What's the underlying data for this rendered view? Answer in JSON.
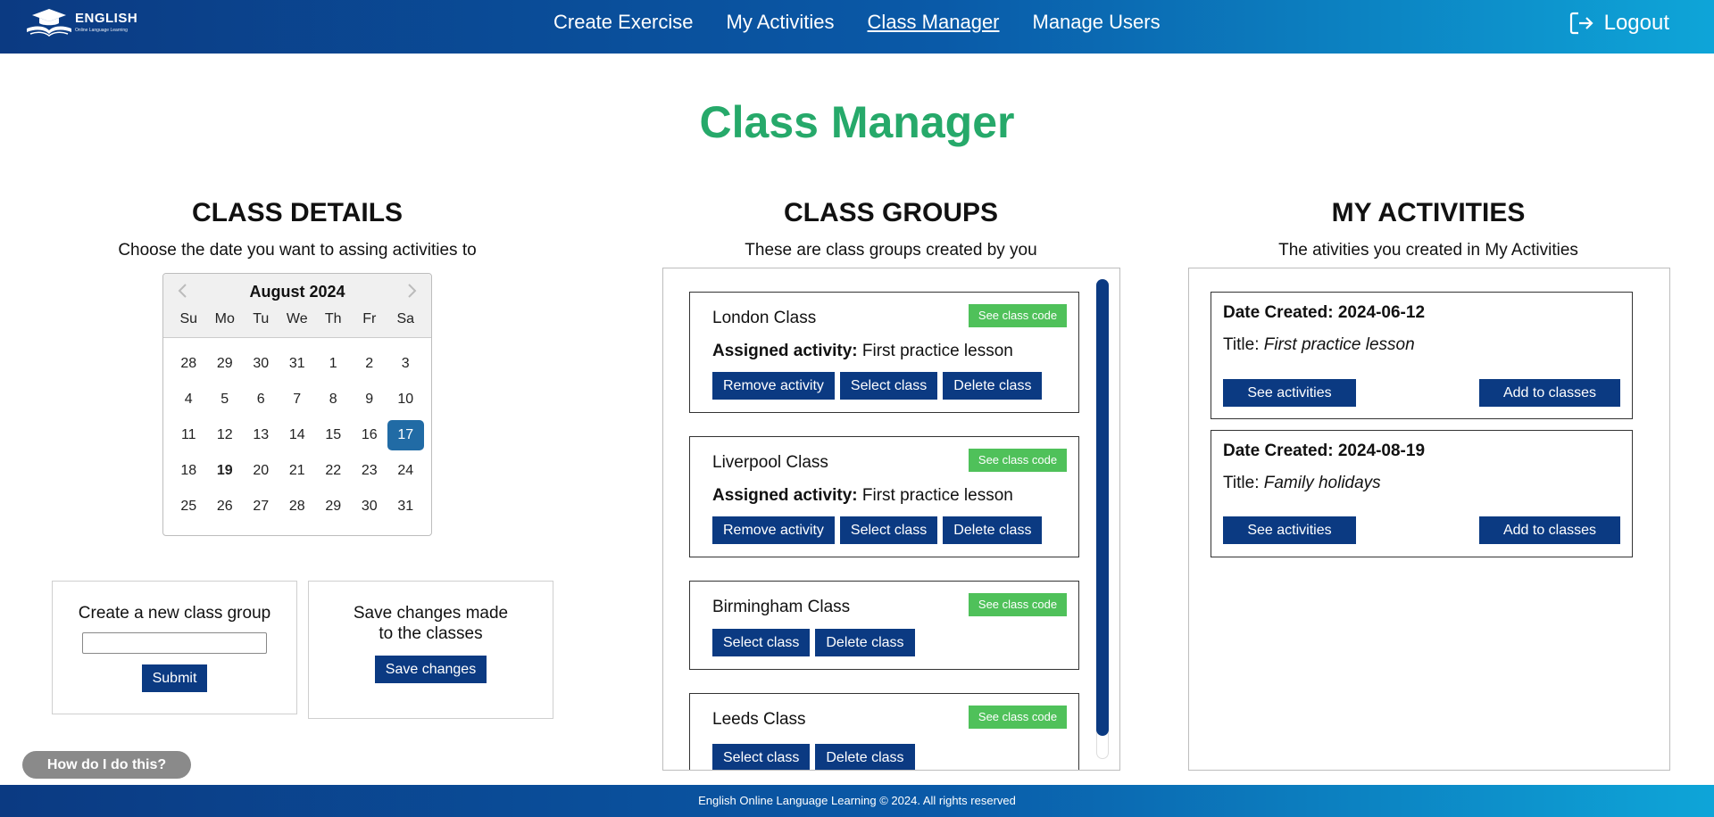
{
  "header": {
    "logo_title": "ENGLISH",
    "logo_subtitle": "Online Language Learning",
    "nav": [
      "Create Exercise",
      "My Activities",
      "Class Manager",
      "Manage Users"
    ],
    "active_nav": "Class Manager",
    "logout": "Logout"
  },
  "page_title": "Class Manager",
  "class_details": {
    "heading": "CLASS DETAILS",
    "subtitle": "Choose the date you want to assing activities to",
    "calendar": {
      "month": "August 2024",
      "weekdays": [
        "Su",
        "Mo",
        "Tu",
        "We",
        "Th",
        "Fr",
        "Sa"
      ],
      "days": [
        "28",
        "29",
        "30",
        "31",
        "1",
        "2",
        "3",
        "4",
        "5",
        "6",
        "7",
        "8",
        "9",
        "10",
        "11",
        "12",
        "13",
        "14",
        "15",
        "16",
        "17",
        "18",
        "19",
        "20",
        "21",
        "22",
        "23",
        "24",
        "25",
        "26",
        "27",
        "28",
        "29",
        "30",
        "31"
      ],
      "selected_day": "17",
      "today": "19"
    },
    "new_group": {
      "label": "Create a new class group",
      "value": "",
      "submit": "Submit"
    },
    "save": {
      "label_line1": "Save changes made",
      "label_line2": "to the classes",
      "button": "Save changes"
    }
  },
  "class_groups": {
    "heading": "CLASS GROUPS",
    "subtitle": "These are class groups created by you",
    "code_label": "See class code",
    "assigned_label": "Assigned activity:",
    "remove_label": "Remove activity",
    "select_label": "Select class",
    "delete_label": "Delete class",
    "groups": [
      {
        "name": "London Class",
        "assigned": "First practice lesson"
      },
      {
        "name": "Liverpool Class",
        "assigned": "First practice lesson"
      },
      {
        "name": "Birmingham Class",
        "assigned": ""
      },
      {
        "name": "Leeds Class",
        "assigned": ""
      }
    ]
  },
  "my_activities": {
    "heading": "MY ACTIVITIES",
    "subtitle": "The ativities you created in My Activities",
    "date_prefix": "Date Created:",
    "title_prefix": "Title:",
    "see_label": "See activities",
    "add_label": "Add to classes",
    "items": [
      {
        "date": "2024-06-12",
        "title": "First practice lesson"
      },
      {
        "date": "2024-08-19",
        "title": "Family holidays"
      }
    ]
  },
  "help_button": "How do I do this?",
  "footer": "English Online Language Learning © 2024. All rights reserved",
  "colors": {
    "brand_blue": "#0b3a82",
    "title_green": "#26a96a",
    "code_green": "#4fc15a",
    "selected_day": "#216ba5"
  }
}
